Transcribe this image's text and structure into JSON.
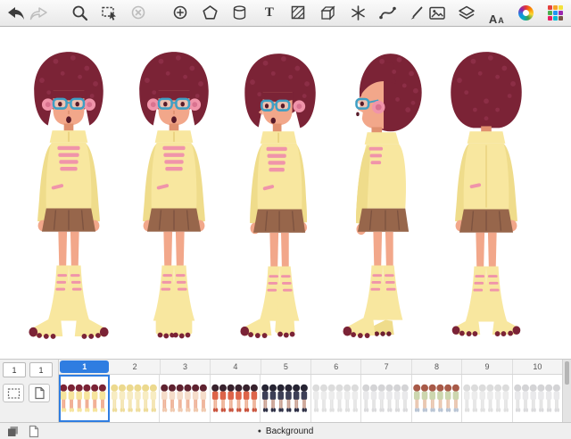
{
  "toolbar": {
    "text_tool_glyph": "T",
    "fonts_tool_glyph_large": "A",
    "fonts_tool_glyph_small": "A",
    "icons": [
      "undo-icon",
      "redo-icon",
      "zoom-icon",
      "marquee-select-icon",
      "deselect-icon",
      "ellipse-tool-icon",
      "polygon-tool-icon",
      "cylinder-tool-icon",
      "text-tool-icon",
      "hatch-tool-icon",
      "mesh-cube-icon",
      "symmetry-icon",
      "curve-tool-icon",
      "pen-tool-icon",
      "image-icon",
      "layers-icon",
      "fonts-icon",
      "color-wheel-icon",
      "color-palette-icon"
    ]
  },
  "canvas": {
    "figures": [
      "front-view",
      "front-view-alt",
      "three-quarter-view",
      "profile-view",
      "back-view"
    ]
  },
  "timeline": {
    "frame_counter": "1",
    "hold_counter": "1",
    "selected_frame": 1,
    "frames": [
      {
        "number": "1",
        "scheme": "color",
        "selected": true
      },
      {
        "number": "2",
        "scheme": "yellow",
        "selected": false
      },
      {
        "number": "3",
        "scheme": "salmon",
        "selected": false
      },
      {
        "number": "4",
        "scheme": "red",
        "selected": false
      },
      {
        "number": "5",
        "scheme": "dark",
        "selected": false
      },
      {
        "number": "6",
        "scheme": "faint",
        "selected": false
      },
      {
        "number": "7",
        "scheme": "faint2",
        "selected": false
      },
      {
        "number": "8",
        "scheme": "mixed",
        "selected": false
      },
      {
        "number": "9",
        "scheme": "faint",
        "selected": false
      },
      {
        "number": "10",
        "scheme": "faint2",
        "selected": false
      }
    ]
  },
  "layer_bar": {
    "dot": "●",
    "label": "Background"
  }
}
